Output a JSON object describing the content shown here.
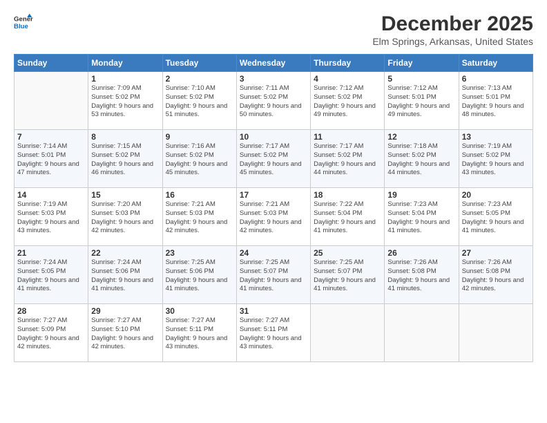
{
  "header": {
    "logo_line1": "General",
    "logo_line2": "Blue",
    "title": "December 2025",
    "subtitle": "Elm Springs, Arkansas, United States"
  },
  "days_of_week": [
    "Sunday",
    "Monday",
    "Tuesday",
    "Wednesday",
    "Thursday",
    "Friday",
    "Saturday"
  ],
  "weeks": [
    [
      {
        "day": "",
        "sunrise": "",
        "sunset": "",
        "daylight": ""
      },
      {
        "day": "1",
        "sunrise": "Sunrise: 7:09 AM",
        "sunset": "Sunset: 5:02 PM",
        "daylight": "Daylight: 9 hours and 53 minutes."
      },
      {
        "day": "2",
        "sunrise": "Sunrise: 7:10 AM",
        "sunset": "Sunset: 5:02 PM",
        "daylight": "Daylight: 9 hours and 51 minutes."
      },
      {
        "day": "3",
        "sunrise": "Sunrise: 7:11 AM",
        "sunset": "Sunset: 5:02 PM",
        "daylight": "Daylight: 9 hours and 50 minutes."
      },
      {
        "day": "4",
        "sunrise": "Sunrise: 7:12 AM",
        "sunset": "Sunset: 5:02 PM",
        "daylight": "Daylight: 9 hours and 49 minutes."
      },
      {
        "day": "5",
        "sunrise": "Sunrise: 7:12 AM",
        "sunset": "Sunset: 5:01 PM",
        "daylight": "Daylight: 9 hours and 49 minutes."
      },
      {
        "day": "6",
        "sunrise": "Sunrise: 7:13 AM",
        "sunset": "Sunset: 5:01 PM",
        "daylight": "Daylight: 9 hours and 48 minutes."
      }
    ],
    [
      {
        "day": "7",
        "sunrise": "Sunrise: 7:14 AM",
        "sunset": "Sunset: 5:01 PM",
        "daylight": "Daylight: 9 hours and 47 minutes."
      },
      {
        "day": "8",
        "sunrise": "Sunrise: 7:15 AM",
        "sunset": "Sunset: 5:02 PM",
        "daylight": "Daylight: 9 hours and 46 minutes."
      },
      {
        "day": "9",
        "sunrise": "Sunrise: 7:16 AM",
        "sunset": "Sunset: 5:02 PM",
        "daylight": "Daylight: 9 hours and 45 minutes."
      },
      {
        "day": "10",
        "sunrise": "Sunrise: 7:17 AM",
        "sunset": "Sunset: 5:02 PM",
        "daylight": "Daylight: 9 hours and 45 minutes."
      },
      {
        "day": "11",
        "sunrise": "Sunrise: 7:17 AM",
        "sunset": "Sunset: 5:02 PM",
        "daylight": "Daylight: 9 hours and 44 minutes."
      },
      {
        "day": "12",
        "sunrise": "Sunrise: 7:18 AM",
        "sunset": "Sunset: 5:02 PM",
        "daylight": "Daylight: 9 hours and 44 minutes."
      },
      {
        "day": "13",
        "sunrise": "Sunrise: 7:19 AM",
        "sunset": "Sunset: 5:02 PM",
        "daylight": "Daylight: 9 hours and 43 minutes."
      }
    ],
    [
      {
        "day": "14",
        "sunrise": "Sunrise: 7:19 AM",
        "sunset": "Sunset: 5:03 PM",
        "daylight": "Daylight: 9 hours and 43 minutes."
      },
      {
        "day": "15",
        "sunrise": "Sunrise: 7:20 AM",
        "sunset": "Sunset: 5:03 PM",
        "daylight": "Daylight: 9 hours and 42 minutes."
      },
      {
        "day": "16",
        "sunrise": "Sunrise: 7:21 AM",
        "sunset": "Sunset: 5:03 PM",
        "daylight": "Daylight: 9 hours and 42 minutes."
      },
      {
        "day": "17",
        "sunrise": "Sunrise: 7:21 AM",
        "sunset": "Sunset: 5:03 PM",
        "daylight": "Daylight: 9 hours and 42 minutes."
      },
      {
        "day": "18",
        "sunrise": "Sunrise: 7:22 AM",
        "sunset": "Sunset: 5:04 PM",
        "daylight": "Daylight: 9 hours and 41 minutes."
      },
      {
        "day": "19",
        "sunrise": "Sunrise: 7:23 AM",
        "sunset": "Sunset: 5:04 PM",
        "daylight": "Daylight: 9 hours and 41 minutes."
      },
      {
        "day": "20",
        "sunrise": "Sunrise: 7:23 AM",
        "sunset": "Sunset: 5:05 PM",
        "daylight": "Daylight: 9 hours and 41 minutes."
      }
    ],
    [
      {
        "day": "21",
        "sunrise": "Sunrise: 7:24 AM",
        "sunset": "Sunset: 5:05 PM",
        "daylight": "Daylight: 9 hours and 41 minutes."
      },
      {
        "day": "22",
        "sunrise": "Sunrise: 7:24 AM",
        "sunset": "Sunset: 5:06 PM",
        "daylight": "Daylight: 9 hours and 41 minutes."
      },
      {
        "day": "23",
        "sunrise": "Sunrise: 7:25 AM",
        "sunset": "Sunset: 5:06 PM",
        "daylight": "Daylight: 9 hours and 41 minutes."
      },
      {
        "day": "24",
        "sunrise": "Sunrise: 7:25 AM",
        "sunset": "Sunset: 5:07 PM",
        "daylight": "Daylight: 9 hours and 41 minutes."
      },
      {
        "day": "25",
        "sunrise": "Sunrise: 7:25 AM",
        "sunset": "Sunset: 5:07 PM",
        "daylight": "Daylight: 9 hours and 41 minutes."
      },
      {
        "day": "26",
        "sunrise": "Sunrise: 7:26 AM",
        "sunset": "Sunset: 5:08 PM",
        "daylight": "Daylight: 9 hours and 41 minutes."
      },
      {
        "day": "27",
        "sunrise": "Sunrise: 7:26 AM",
        "sunset": "Sunset: 5:08 PM",
        "daylight": "Daylight: 9 hours and 42 minutes."
      }
    ],
    [
      {
        "day": "28",
        "sunrise": "Sunrise: 7:27 AM",
        "sunset": "Sunset: 5:09 PM",
        "daylight": "Daylight: 9 hours and 42 minutes."
      },
      {
        "day": "29",
        "sunrise": "Sunrise: 7:27 AM",
        "sunset": "Sunset: 5:10 PM",
        "daylight": "Daylight: 9 hours and 42 minutes."
      },
      {
        "day": "30",
        "sunrise": "Sunrise: 7:27 AM",
        "sunset": "Sunset: 5:11 PM",
        "daylight": "Daylight: 9 hours and 43 minutes."
      },
      {
        "day": "31",
        "sunrise": "Sunrise: 7:27 AM",
        "sunset": "Sunset: 5:11 PM",
        "daylight": "Daylight: 9 hours and 43 minutes."
      },
      {
        "day": "",
        "sunrise": "",
        "sunset": "",
        "daylight": ""
      },
      {
        "day": "",
        "sunrise": "",
        "sunset": "",
        "daylight": ""
      },
      {
        "day": "",
        "sunrise": "",
        "sunset": "",
        "daylight": ""
      }
    ]
  ]
}
